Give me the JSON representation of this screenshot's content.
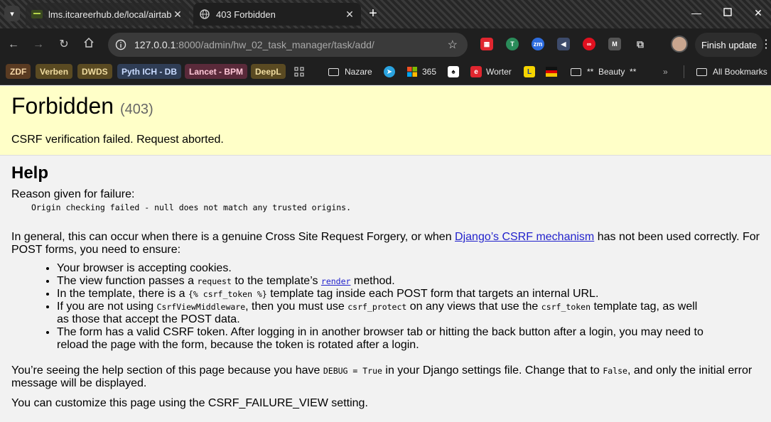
{
  "browser": {
    "tabs": [
      {
        "title": "lms.itcareerhub.de/local/airtabl",
        "active": false
      },
      {
        "title": "403 Forbidden",
        "active": true
      }
    ],
    "url_host": "127.0.0.1",
    "url_rest": ":8000/admin/hw_02_task_manager/task/add/",
    "finish_update_label": "Finish update",
    "bookmark_chips": [
      {
        "label": "ZDF",
        "bg": "#5a3b22",
        "fg": "#f6d7a7"
      },
      {
        "label": "Verben",
        "bg": "#5a4a22",
        "fg": "#f0dca0"
      },
      {
        "label": "DWDS",
        "bg": "#5a4a22",
        "fg": "#f0dca0"
      },
      {
        "label": "Pyth ICH - DB",
        "bg": "#2f3d55",
        "fg": "#c9dbff"
      },
      {
        "label": "Lancet - BPM",
        "bg": "#5a2a3a",
        "fg": "#ffc7d7"
      },
      {
        "label": "DeepL",
        "bg": "#5a4a22",
        "fg": "#f0dca0"
      }
    ],
    "bookmarks": [
      {
        "label": "Nazare"
      },
      {
        "label": ""
      },
      {
        "label": "365"
      },
      {
        "label": ""
      },
      {
        "label": "Worter"
      },
      {
        "label": ""
      },
      {
        "label": ""
      },
      {
        "label": "**  Beauty  **"
      },
      {
        "label": "All Bookmarks"
      }
    ]
  },
  "page": {
    "title": "Forbidden",
    "status_code": "(403)",
    "summary_message": "CSRF verification failed. Request aborted.",
    "help_heading": "Help",
    "reason_label": "Reason given for failure:",
    "reason_detail": "Origin checking failed - null does not match any trusted origins.",
    "general_text_before_link": "In general, this can occur when there is a genuine Cross Site Request Forgery, or when ",
    "general_link": "Django’s CSRF mechanism",
    "general_text_after_link": " has not been used correctly. For POST forms, you need to ensure:",
    "bullets": {
      "b1": "Your browser is accepting cookies.",
      "b2_a": "The view function passes a ",
      "b2_code": "request",
      "b2_b": " to the template’s ",
      "b2_link": "render",
      "b2_c": " method.",
      "b3_a": "In the template, there is a ",
      "b3_code": "{% csrf_token %}",
      "b3_b": " template tag inside each POST form that targets an internal URL.",
      "b4_a": "If you are not using ",
      "b4_code1": "CsrfViewMiddleware",
      "b4_b": ", then you must use ",
      "b4_code2": "csrf_protect",
      "b4_c": " on any views that use the ",
      "b4_code3": "csrf_token",
      "b4_d": " template tag, as well as those that accept the POST data.",
      "b5": "The form has a valid CSRF token. After logging in in another browser tab or hitting the back button after a login, you may need to reload the page with the form, because the token is rotated after a login."
    },
    "debug_a": "You’re seeing the help section of this page because you have ",
    "debug_code1": "DEBUG = True",
    "debug_b": " in your Django settings file. Change that to ",
    "debug_code2": "False",
    "debug_c": ", and only the initial error message will be displayed.",
    "customize_text": "You can customize this page using the CSRF_FAILURE_VIEW setting."
  }
}
